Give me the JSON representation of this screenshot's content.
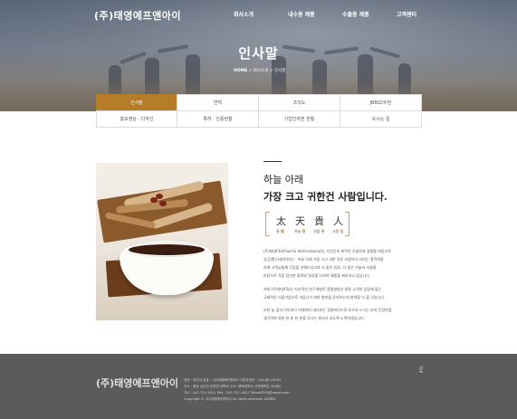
{
  "header": {
    "logo": "(주)태영에프앤아이",
    "nav": [
      "회사소개",
      "내수용 제품",
      "수출용 제품",
      "고객센터"
    ]
  },
  "hero": {
    "title": "인사말",
    "breadcrumb_home": "HOME",
    "breadcrumb_rest": " > 회사소개 > 인사말"
  },
  "tabs": {
    "row1": [
      "인사말",
      "연혁",
      "조직도",
      "JBBIZ/비전"
    ],
    "row2": [
      "홍보영상 · 디자인",
      "특허 · 인증현황",
      "기업인력현 현황",
      "오시는 길"
    ],
    "active": "인사말"
  },
  "content": {
    "heading_line1": "하늘 아래",
    "heading_line2": "가장 크고 귀한건 사람입니다.",
    "hanja": [
      "太",
      "天",
      "貴",
      "人"
    ],
    "readings": [
      {
        "prefix": "클",
        "char": "태"
      },
      {
        "prefix": "하늘",
        "char": "천"
      },
      {
        "prefix": "귀할",
        "char": "귀"
      },
      {
        "prefix": "사람",
        "char": "인"
      }
    ],
    "para1": [
      "(주)태영F&I(Food & International)는 다년간의 축적된 기술력과 경험을 바탕으로",
      "太天貴人(태천귀인) : 하늘 아래 가장 크고 귀한 것은 사람이다 라라는 철학처럼",
      "아래 고객님들께 건강을 전해드리고자 더 좋은 원료, 더 좋은 기술과 서설을",
      "바탕으로 직접 엄선한 원료와 정성을 다하여 제품을 제조하고 있습니다."
    ],
    "para2": [
      "저희 (주)태영F&I는 지속적인 연구개발로 품질향상은 물론 고객의 입장에 맞는",
      "국제적인 식품기업으로 거듭나기 위한 발판을 준비하는데 총력을 다 할 것입니다."
    ],
    "para3": [
      "또한 늘 앞서 이익보다 미래까지 내다보는 경영마인드로 모오지 드시는 분의 건강만을",
      "생각하며 위한 한 분 한 분을 모시는 회사가 되도록 노력하겠습니다."
    ]
  },
  "footer": {
    "logo": "(주)태영에프앤아이",
    "lines": [
      "대표 : 김인석     상호 : (주)태영에프앤아이     사업자번호 : 314-86-10264",
      "주소 : 충남 금산군 추부면 대학로 201 (충북대학교 산학협력단 403호)",
      "TEL : 041-751-1611     FAX : 041-751-1612     Tyfood3333@naver.com",
      "Copyright © (주)태영에프앤아이 All rights reserved.   ADMIN"
    ],
    "top_button": "TOP"
  },
  "colors": {
    "accent": "#b57d28",
    "footer_bg": "#5b5b5b"
  }
}
